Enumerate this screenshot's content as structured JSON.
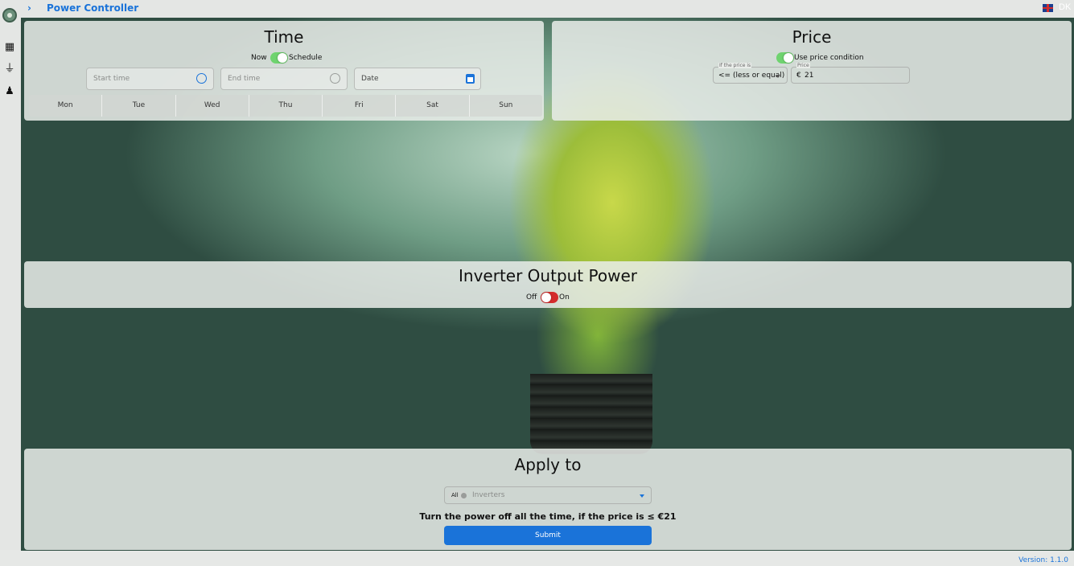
{
  "header": {
    "chevron": "›",
    "title": "Power Controller",
    "lang_flag": "uk-flag-icon",
    "lang_alt": "DK"
  },
  "sidebar": {
    "icons": [
      "solar-panel-icon",
      "plug-icon",
      "bell-icon"
    ]
  },
  "time_panel": {
    "title": "Time",
    "toggle_left": "Now",
    "toggle_right": "Schedule",
    "start_placeholder": "Start time",
    "end_placeholder": "End time",
    "date_placeholder": "Date",
    "days": [
      "Mon",
      "Tue",
      "Wed",
      "Thu",
      "Fri",
      "Sat",
      "Sun"
    ]
  },
  "price_panel": {
    "title": "Price",
    "toggle_label": "Use price condition",
    "condition_label": "If the price is",
    "condition_value": "<= (less or equal)",
    "price_label": "Price",
    "currency": "€",
    "price_value": "21"
  },
  "power_panel": {
    "title": "Inverter Output Power",
    "off_label": "Off",
    "on_label": "On"
  },
  "apply_panel": {
    "title": "Apply to",
    "chip": "All",
    "select_placeholder": "Inverters",
    "summary": "Turn the power off all the time, if the price is ≤ €21",
    "submit": "Submit"
  },
  "footer": {
    "version": "Version: 1.1.0"
  },
  "colors": {
    "accent": "#1a73d9",
    "toggle_on": "#6fd36f",
    "toggle_off_red": "#d42c2c"
  }
}
